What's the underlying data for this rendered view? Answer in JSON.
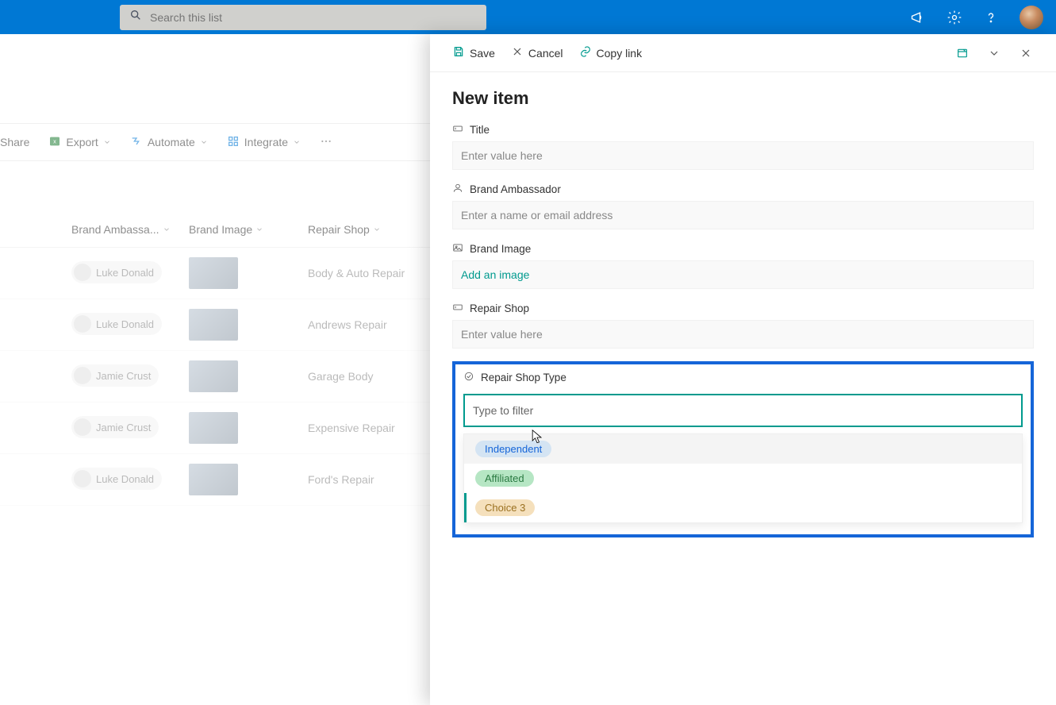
{
  "header": {
    "search_placeholder": "Search this list"
  },
  "commands": {
    "share": "Share",
    "export": "Export",
    "automate": "Automate",
    "integrate": "Integrate"
  },
  "columns": {
    "brand_ambassador": "Brand Ambassa...",
    "brand_image": "Brand Image",
    "repair_shop": "Repair Shop"
  },
  "rows": [
    {
      "ambassador": "Luke Donald",
      "repair_shop": "Body & Auto Repair"
    },
    {
      "ambassador": "Luke Donald",
      "repair_shop": "Andrews Repair"
    },
    {
      "ambassador": "Jamie Crust",
      "repair_shop": "Garage Body"
    },
    {
      "ambassador": "Jamie Crust",
      "repair_shop": "Expensive Repair"
    },
    {
      "ambassador": "Luke Donald",
      "repair_shop": "Ford's Repair"
    }
  ],
  "panel": {
    "actions": {
      "save": "Save",
      "cancel": "Cancel",
      "copy_link": "Copy link"
    },
    "title": "New item",
    "fields": {
      "title": {
        "label": "Title",
        "placeholder": "Enter value here"
      },
      "brand_ambassador": {
        "label": "Brand Ambassador",
        "placeholder": "Enter a name or email address"
      },
      "brand_image": {
        "label": "Brand Image",
        "link": "Add an image"
      },
      "repair_shop": {
        "label": "Repair Shop",
        "placeholder": "Enter value here"
      },
      "repair_shop_type": {
        "label": "Repair Shop Type",
        "filter_placeholder": "Type to filter",
        "options": [
          "Independent",
          "Affiliated",
          "Choice 3"
        ]
      }
    }
  }
}
